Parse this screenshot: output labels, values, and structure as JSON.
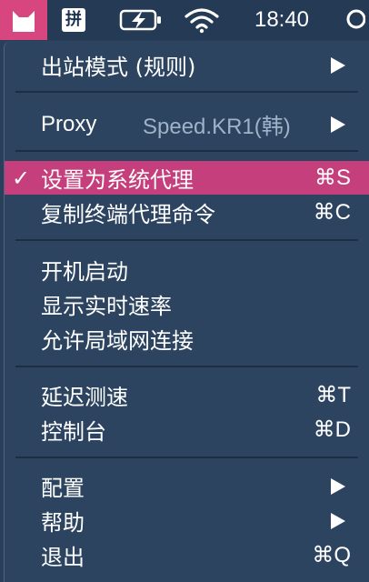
{
  "menubar": {
    "ime_label": "拼",
    "clock": "18:40"
  },
  "menu": {
    "outbound_mode_label": "出站模式 (规则)",
    "proxy_label": "Proxy",
    "proxy_value": "Speed.KR1(韩)",
    "set_system_proxy_label": "设置为系统代理",
    "set_system_proxy_shortcut": "⌘S",
    "checkmark": "✓",
    "copy_terminal_cmd_label": "复制终端代理命令",
    "copy_terminal_cmd_shortcut": "⌘C",
    "launch_at_login_label": "开机启动",
    "show_realtime_speed_label": "显示实时速率",
    "allow_lan_label": "允许局域网连接",
    "latency_test_label": "延迟测速",
    "latency_test_shortcut": "⌘T",
    "dashboard_label": "控制台",
    "dashboard_shortcut": "⌘D",
    "config_label": "配置",
    "help_label": "帮助",
    "quit_label": "退出",
    "quit_shortcut": "⌘Q"
  },
  "colors": {
    "accent": "#c43f7b",
    "menu_bg": "#2d4460",
    "menubar_bg": "#243a55"
  }
}
